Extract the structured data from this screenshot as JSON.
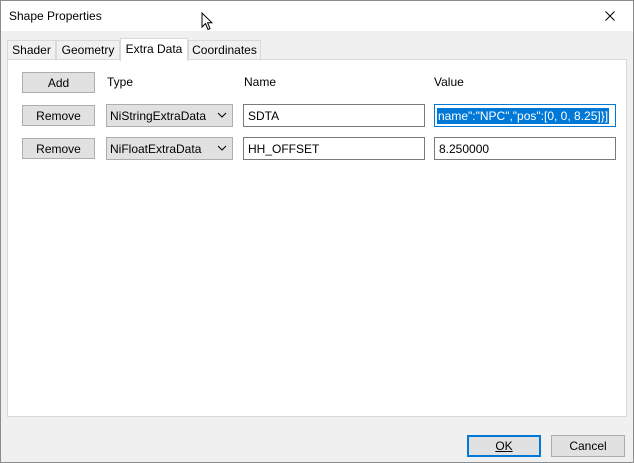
{
  "window": {
    "title": "Shape Properties"
  },
  "tabs": [
    {
      "label": "Shader"
    },
    {
      "label": "Geometry"
    },
    {
      "label": "Extra Data"
    },
    {
      "label": "Coordinates"
    }
  ],
  "active_tab": "Extra Data",
  "extra_data": {
    "add_label": "Add",
    "col_type": "Type",
    "col_name": "Name",
    "col_value": "Value",
    "rows": [
      {
        "remove_label": "Remove",
        "type": "NiStringExtraData",
        "name": "SDTA",
        "value": "name\":\"NPC\",\"pos\":[0, 0, 8.25]}]"
      },
      {
        "remove_label": "Remove",
        "type": "NiFloatExtraData",
        "name": "HH_OFFSET",
        "value": "8.250000"
      }
    ]
  },
  "footer": {
    "ok_label": "OK",
    "cancel_label": "Cancel"
  },
  "icons": {
    "close": "close-icon",
    "dropdown": "chevron-down-icon",
    "cursor": "mouse-cursor-icon"
  }
}
